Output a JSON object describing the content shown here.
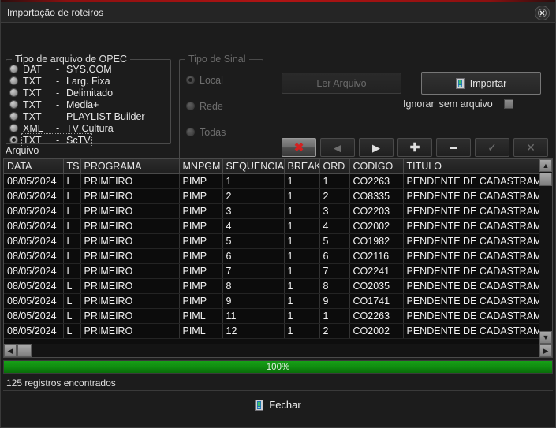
{
  "window": {
    "title": "Importação de roteiros",
    "close_icon": "close-circle-icon"
  },
  "file_type_group": {
    "legend": "Tipo de arquivo  de OPEC",
    "options": [
      {
        "key": "DAT",
        "dash": "-",
        "value": "SYS.COM",
        "selected": false
      },
      {
        "key": "TXT",
        "dash": "-",
        "value": "Larg. Fixa",
        "selected": false
      },
      {
        "key": "TXT",
        "dash": "-",
        "value": "Delimitado",
        "selected": false
      },
      {
        "key": "TXT",
        "dash": "-",
        "value": "Media+",
        "selected": false
      },
      {
        "key": "TXT",
        "dash": "-",
        "value": "PLAYLIST Builder",
        "selected": false
      },
      {
        "key": "XML",
        "dash": "-",
        "value": "TV Cultura",
        "selected": false
      },
      {
        "key": "TXT",
        "dash": "-",
        "value": "ScTV",
        "selected": true
      }
    ]
  },
  "signal_type_group": {
    "legend": "Tipo de Sinal",
    "disabled": true,
    "options": [
      {
        "value": "Local",
        "selected": true
      },
      {
        "value": "Rede",
        "selected": false
      },
      {
        "value": "Todas",
        "selected": false
      }
    ]
  },
  "actions": {
    "read_file_label": "Ler Arquivo",
    "read_file_disabled": true,
    "import_label": "Importar",
    "import_icon": "import-document-icon",
    "ignore_label_1": "Ignorar",
    "ignore_label_2": "sem arquivo",
    "ignore_checked": false
  },
  "navbar": {
    "buttons": [
      {
        "name": "cancel-button",
        "icon": "red-x-icon",
        "glyph": "✖",
        "highlighted": true,
        "disabled": false
      },
      {
        "name": "previous-button",
        "icon": "arrow-left-icon",
        "glyph": "◀",
        "highlighted": false,
        "disabled": true
      },
      {
        "name": "next-button",
        "icon": "arrow-right-icon",
        "glyph": "▶",
        "highlighted": false,
        "disabled": false
      },
      {
        "name": "add-button",
        "icon": "plus-icon",
        "glyph": "✚",
        "highlighted": false,
        "disabled": false
      },
      {
        "name": "remove-button",
        "icon": "minus-icon",
        "glyph": "▬",
        "highlighted": false,
        "disabled": false
      },
      {
        "name": "confirm-button",
        "icon": "check-icon",
        "glyph": "✓",
        "highlighted": false,
        "disabled": true
      },
      {
        "name": "close-row-button",
        "icon": "x-icon",
        "glyph": "✕",
        "highlighted": false,
        "disabled": true
      }
    ]
  },
  "grid": {
    "section_label": "Arquivo",
    "columns": [
      "DATA",
      "TS",
      "PROGRAMA",
      "MNPGM",
      "SEQUENCIA",
      "BREAK",
      "ORD",
      "CODIGO",
      "TITULO"
    ],
    "rows": [
      [
        "08/05/2024",
        "L",
        "PRIMEIRO",
        "PIMP",
        "1",
        "1",
        "1",
        "CO2263",
        "PENDENTE DE CADASTRAMENTO"
      ],
      [
        "08/05/2024",
        "L",
        "PRIMEIRO",
        "PIMP",
        "2",
        "1",
        "2",
        "CO8335",
        "PENDENTE DE CADASTRAMENTO"
      ],
      [
        "08/05/2024",
        "L",
        "PRIMEIRO",
        "PIMP",
        "3",
        "1",
        "3",
        "CO2203",
        "PENDENTE DE CADASTRAMENTO"
      ],
      [
        "08/05/2024",
        "L",
        "PRIMEIRO",
        "PIMP",
        "4",
        "1",
        "4",
        "CO2002",
        "PENDENTE DE CADASTRAMENTO"
      ],
      [
        "08/05/2024",
        "L",
        "PRIMEIRO",
        "PIMP",
        "5",
        "1",
        "5",
        "CO1982",
        "PENDENTE DE CADASTRAMENTO"
      ],
      [
        "08/05/2024",
        "L",
        "PRIMEIRO",
        "PIMP",
        "6",
        "1",
        "6",
        "CO2116",
        "PENDENTE DE CADASTRAMENTO"
      ],
      [
        "08/05/2024",
        "L",
        "PRIMEIRO",
        "PIMP",
        "7",
        "1",
        "7",
        "CO2241",
        "PENDENTE DE CADASTRAMENTO"
      ],
      [
        "08/05/2024",
        "L",
        "PRIMEIRO",
        "PIMP",
        "8",
        "1",
        "8",
        "CO2035",
        "PENDENTE DE CADASTRAMENTO"
      ],
      [
        "08/05/2024",
        "L",
        "PRIMEIRO",
        "PIMP",
        "9",
        "1",
        "9",
        "CO1741",
        "PENDENTE DE CADASTRAMENTO"
      ],
      [
        "08/05/2024",
        "L",
        "PRIMEIRO",
        "PIML",
        "11",
        "1",
        "1",
        "CO2263",
        "PENDENTE DE CADASTRAMENTO"
      ],
      [
        "08/05/2024",
        "L",
        "PRIMEIRO",
        "PIML",
        "12",
        "1",
        "2",
        "CO2002",
        "PENDENTE DE CADASTRAMENTO"
      ]
    ]
  },
  "progress": {
    "percent": 100,
    "text": "100%",
    "color": "#0f8a0f"
  },
  "status": {
    "text": "125 registros encontrados"
  },
  "footer": {
    "close_label": "Fechar",
    "close_icon": "close-document-icon"
  }
}
